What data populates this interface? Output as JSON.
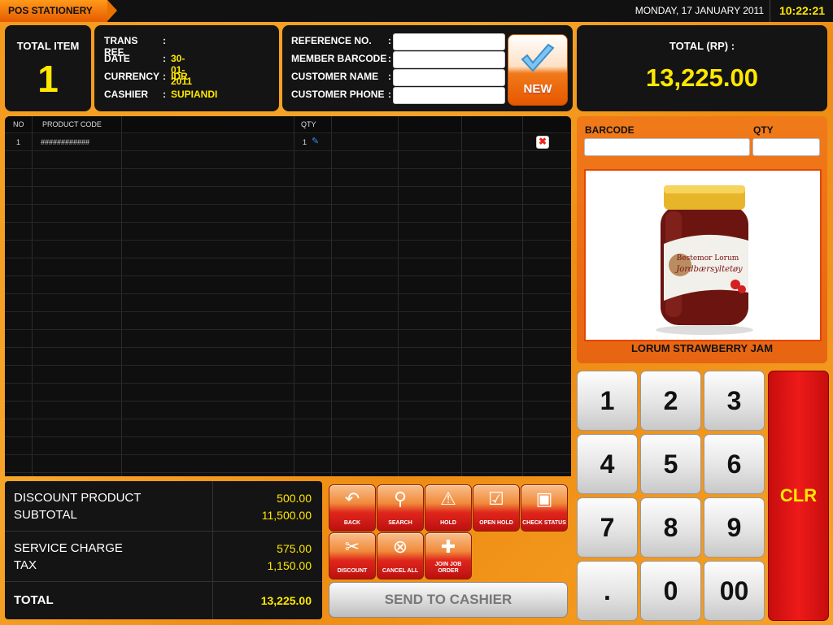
{
  "header": {
    "app_name": "POS STATIONERY",
    "date": "MONDAY, 17 JANUARY 2011",
    "time": "10:22:21"
  },
  "total_item": {
    "label": "TOTAL ITEM",
    "value": "1"
  },
  "trans": {
    "rows": [
      {
        "label": "TRANS REF.",
        "colon": ":",
        "value": ""
      },
      {
        "label": "DATE",
        "colon": ":",
        "value": "30-01-2011"
      },
      {
        "label": "CURRENCY",
        "colon": ":",
        "value": "IDR"
      },
      {
        "label": "CASHIER",
        "colon": ":",
        "value": "SUPIANDI"
      }
    ]
  },
  "reference": {
    "fields": [
      {
        "label": "REFERENCE NO.",
        "colon": ":",
        "value": ""
      },
      {
        "label": "MEMBER BARCODE",
        "colon": ":",
        "value": ""
      },
      {
        "label": "CUSTOMER NAME",
        "colon": ":",
        "value": ""
      },
      {
        "label": "CUSTOMER PHONE",
        "colon": ":",
        "value": ""
      }
    ],
    "new_label": "NEW"
  },
  "grand_total": {
    "label": "TOTAL (RP) :",
    "value": "13,225.00"
  },
  "grid": {
    "columns": [
      "NO",
      "PRODUCT CODE",
      "QTY"
    ],
    "rows": [
      {
        "no": "1",
        "code": "############",
        "qty": "1"
      }
    ]
  },
  "summary": {
    "discount_label": "DISCOUNT PRODUCT",
    "discount_value": "500.00",
    "subtotal_label": "SUBTOTAL",
    "subtotal_value": "11,500.00",
    "service_label": "SERVICE CHARGE",
    "service_value": "575.00",
    "tax_label": "TAX",
    "tax_value": "1,150.00",
    "total_label": "TOTAL",
    "total_value": "13,225.00"
  },
  "actions": {
    "back": "BACK",
    "search": "SEARCH",
    "hold": "HOLD",
    "open_hold": "OPEN HOLD",
    "check_status": "CHECK STATUS",
    "discount": "DISCOUNT",
    "cancel_all": "CANCEL ALL",
    "join_job_order": "JOIN JOB ORDER",
    "send": "SEND TO CASHIER"
  },
  "barcode": {
    "barcode_label": "BARCODE",
    "qty_label": "QTY",
    "product_name": "LORUM STRAWBERRY JAM",
    "jar_label_1": "Bestemor Lorum",
    "jar_label_2": "Jordbærsyltetøy"
  },
  "keypad": {
    "k1": "1",
    "k2": "2",
    "k3": "3",
    "k4": "4",
    "k5": "5",
    "k6": "6",
    "k7": "7",
    "k8": "8",
    "k9": "9",
    "dot": ".",
    "k0": "0",
    "k00": "00",
    "clr": "CLR"
  },
  "colors": {
    "accent": "#ffe800",
    "orange": "#f39a1c",
    "panel": "#141414",
    "clr": "#e51414"
  }
}
